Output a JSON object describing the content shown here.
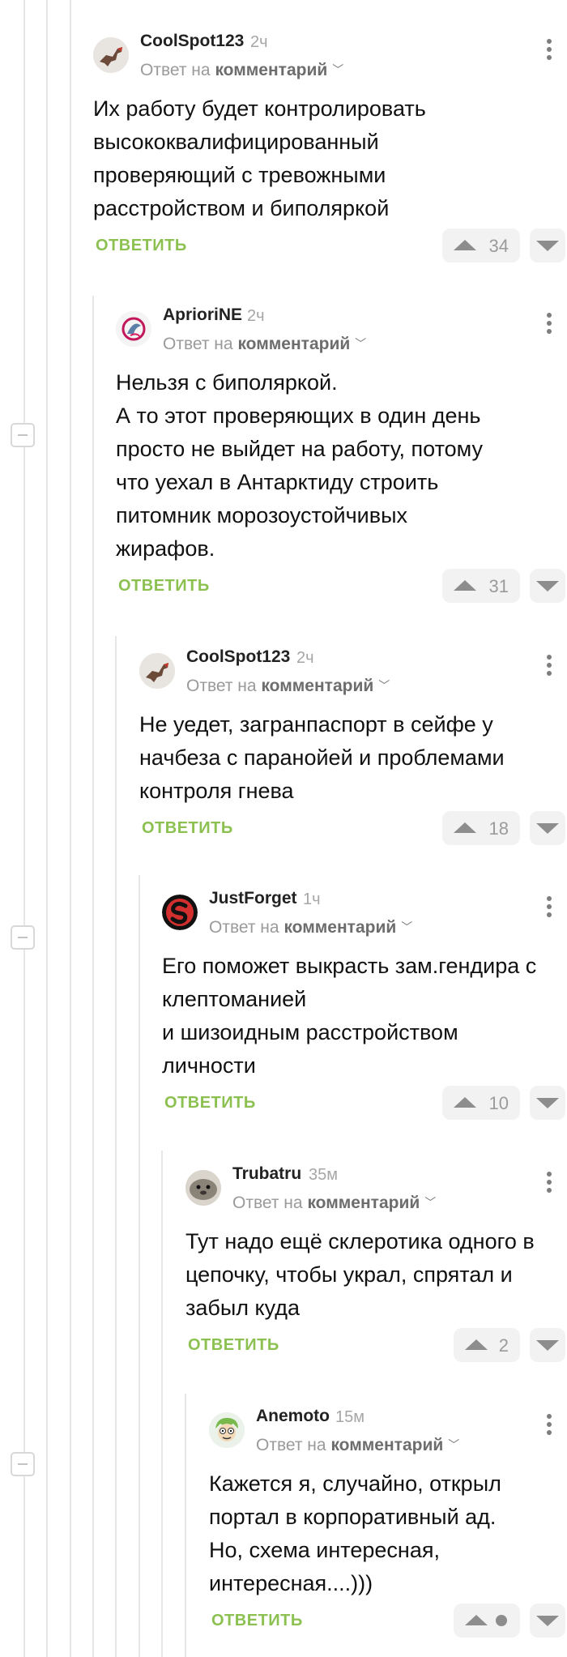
{
  "comments": [
    {
      "user": "CoolSpot123",
      "time": "2ч",
      "reply_prefix": "Ответ на",
      "reply_target": "комментарий",
      "text": "Их работу будет контролировать высококвалифицированный проверяющий с тревожными расстройством и биполяркой",
      "reply_label": "ОТВЕТИТЬ",
      "votes": "34",
      "avatar": "dinosaur-avatar"
    },
    {
      "user": "AprioriNE",
      "time": "2ч",
      "reply_prefix": "Ответ на",
      "reply_target": "комментарий",
      "text": "Нельзя с биполяркой.\nА то этот проверяющих в один день просто не выйдет на работу, потому что уехал в Антарктиду строить питомник морозоустойчивых жирафов.",
      "reply_label": "ОТВЕТИТЬ",
      "votes": "31",
      "avatar": "dragon-logo-avatar"
    },
    {
      "user": "CoolSpot123",
      "time": "2ч",
      "reply_prefix": "Ответ на",
      "reply_target": "комментарий",
      "text": "Не уедет, загранпаспорт в сейфе у начбеза с паранойей и проблемами контроля гнева",
      "reply_label": "ОТВЕТИТЬ",
      "votes": "18",
      "avatar": "dinosaur-avatar"
    },
    {
      "user": "JustForget",
      "time": "1ч",
      "reply_prefix": "Ответ на",
      "reply_target": "комментарий",
      "text": "Его поможет выкрасть зам.гендира с клептоманией\nи шизоидным расстройством личности",
      "reply_label": "ОТВЕТИТЬ",
      "votes": "10",
      "avatar": "red-s-logo-avatar"
    },
    {
      "user": "Trubatru",
      "time": "35м",
      "reply_prefix": "Ответ на",
      "reply_target": "комментарий",
      "text": "Тут надо ещё склеротика одного в цепочку, чтобы украл, спрятал и забыл куда",
      "reply_label": "ОТВЕТИТЬ",
      "votes": "2",
      "avatar": "seal-avatar"
    },
    {
      "user": "Anemoto",
      "time": "15м",
      "reply_prefix": "Ответ на",
      "reply_target": "комментарий",
      "text": "Кажется я, случайно, открыл портал в корпоративный ад. Но, схема интересная, интересная....)))",
      "reply_label": "ОТВЕТИТЬ",
      "votes": "",
      "avatar": "cartoon-face-avatar"
    }
  ],
  "colors": {
    "accent": "#8cc151",
    "thread_line": "#e6e6e6",
    "muted": "#9a9a9a"
  }
}
